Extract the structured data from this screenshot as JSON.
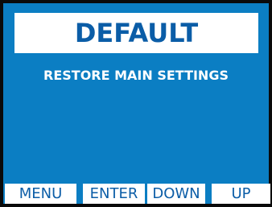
{
  "screen": {
    "title": "DEFAULT",
    "subtitle": "RESTORE MAIN SETTINGS"
  },
  "softkeys": {
    "menu": "MENU",
    "enter": "ENTER",
    "down": "DOWN",
    "up": "UP"
  },
  "colors": {
    "background": "#0b7ec3",
    "frame": "#0a0a0a",
    "title_text": "#0b5da7",
    "softkey_text": "#0b5da7",
    "subtitle_text": "#ffffff"
  }
}
